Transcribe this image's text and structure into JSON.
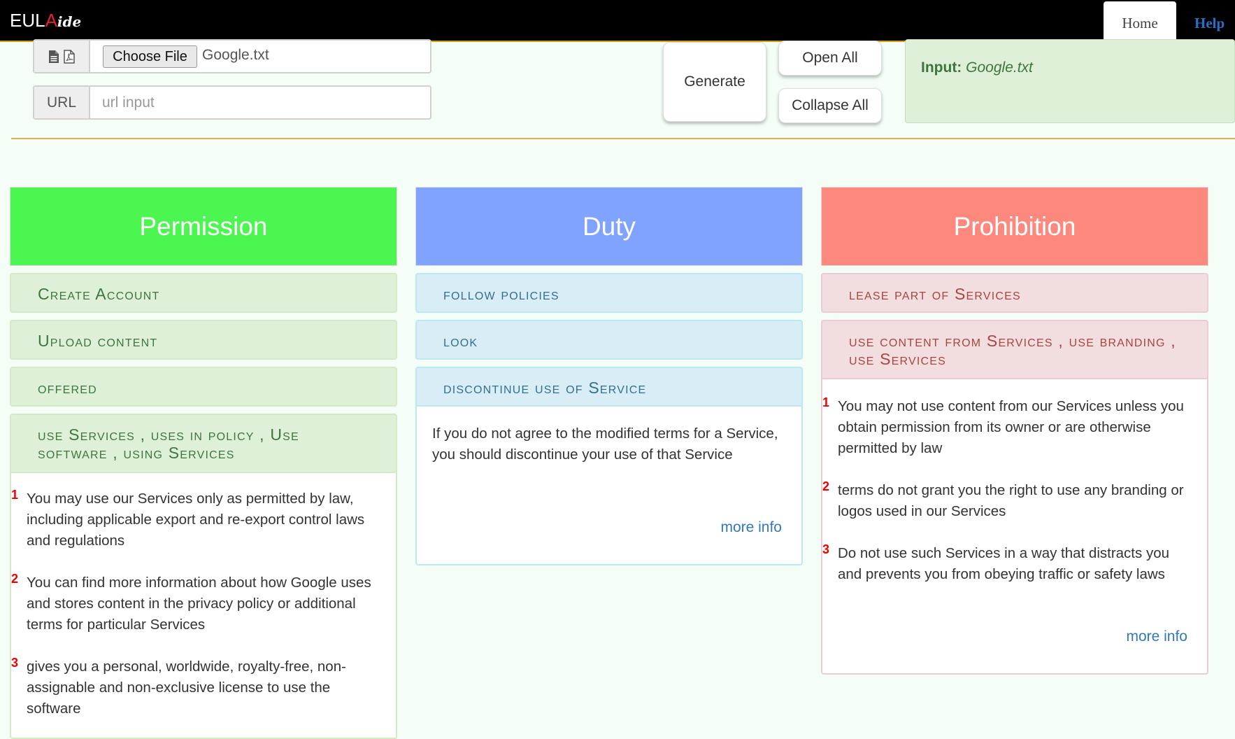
{
  "nav": {
    "brand_part1": "EUL",
    "brand_part2": "A",
    "brand_part3": "ide",
    "home": "Home",
    "help": "Help"
  },
  "file_input": {
    "button_label": "Choose File",
    "file_name": "Google.txt"
  },
  "url_input": {
    "label": "URL",
    "placeholder": "url input",
    "value": ""
  },
  "buttons": {
    "generate": "Generate",
    "open_all": "Open All",
    "collapse_all": "Collapse All"
  },
  "input_panel": {
    "label": "Input:",
    "value": "Google.txt"
  },
  "colors": {
    "permission": "#4cf651",
    "duty": "#80a3ff",
    "prohibition": "#fd887d",
    "accent_line": "#e3b04b"
  },
  "columns": [
    {
      "title": "Permission",
      "items": [
        {
          "label": "Create Account"
        },
        {
          "label": "Upload content"
        },
        {
          "label": "offered"
        },
        {
          "label": "use Services , uses in policy , Use software , using Services",
          "sentences": [
            {
              "num": "1",
              "text": "You may use our Services only as permitted by law, including applicable export and re-export control laws and regulations"
            },
            {
              "num": "2",
              "text": "You can find more information about how Google uses and stores content in the privacy policy or additional terms for particular Services"
            },
            {
              "num": "3",
              "text": "gives you a personal, worldwide, royalty-free, non-assignable and non-exclusive license to use the software"
            }
          ]
        }
      ]
    },
    {
      "title": "Duty",
      "items": [
        {
          "label": "follow policies"
        },
        {
          "label": "look"
        },
        {
          "label": "discontinue use of Service",
          "sentences": [
            {
              "num": "",
              "text": "If you do not agree to the modified terms for a Service, you should discontinue your use of that Service"
            }
          ],
          "more_info": "more info"
        }
      ]
    },
    {
      "title": "Prohibition",
      "items": [
        {
          "label": "lease part of Services"
        },
        {
          "label": "use content from Services , use branding , use Services",
          "sentences": [
            {
              "num": "1",
              "text": "You may not use content from our Services unless you obtain permission from its owner or are otherwise permitted by law"
            },
            {
              "num": "2",
              "text": "terms do not grant you the right to use any branding or logos used in our Services"
            },
            {
              "num": "3",
              "text": "Do not use such Services in a way that distracts you and prevents you from obeying traffic or safety laws"
            }
          ],
          "more_info": "more info"
        }
      ]
    }
  ]
}
